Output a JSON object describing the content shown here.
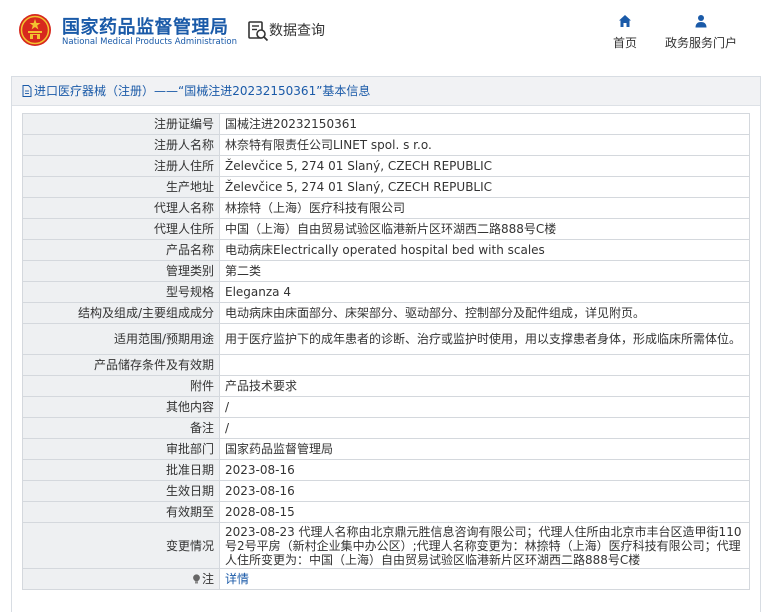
{
  "header": {
    "brand_cn": "国家药品监督管理局",
    "brand_en": "National Medical Products Administration",
    "query_label": "数据查询",
    "nav_home": "首页",
    "nav_portal": "政务服务门户"
  },
  "colors": {
    "brand_blue": "#1a5aa8",
    "label_bg": "#eef0f2",
    "emblem_red": "#d7281e",
    "emblem_gold": "#f2c230"
  },
  "panel": {
    "title": "进口医疗器械（注册）——“国械注进20232150361”基本信息"
  },
  "fields": [
    {
      "label": "注册证编号",
      "value": "国械注进20232150361"
    },
    {
      "label": "注册人名称",
      "value": "林奈特有限责任公司LINET spol. s r.o."
    },
    {
      "label": "注册人住所",
      "value": "Želevčice 5, 274 01 Slaný, CZECH REPUBLIC"
    },
    {
      "label": "生产地址",
      "value": "Želevčice 5, 274 01 Slaný, CZECH REPUBLIC"
    },
    {
      "label": "代理人名称",
      "value": "林捺特（上海）医疗科技有限公司"
    },
    {
      "label": "代理人住所",
      "value": "中国（上海）自由贸易试验区临港新片区环湖西二路888号C楼"
    },
    {
      "label": "产品名称",
      "value": "电动病床Electrically operated hospital bed with scales"
    },
    {
      "label": "管理类别",
      "value": "第二类"
    },
    {
      "label": "型号规格",
      "value": "Eleganza 4"
    },
    {
      "label": "结构及组成/主要组成成分",
      "value": "电动病床由床面部分、床架部分、驱动部分、控制部分及配件组成，详见附页。"
    },
    {
      "label": "适用范围/预期用途",
      "value": "用于医疗监护下的成年患者的诊断、治疗或监护时使用，用以支撑患者身体，形成临床所需体位。"
    },
    {
      "label": "产品储存条件及有效期",
      "value": ""
    },
    {
      "label": "附件",
      "value": "产品技术要求"
    },
    {
      "label": "其他内容",
      "value": "/"
    },
    {
      "label": "备注",
      "value": "/"
    },
    {
      "label": "审批部门",
      "value": "国家药品监督管理局"
    },
    {
      "label": "批准日期",
      "value": "2023-08-16"
    },
    {
      "label": "生效日期",
      "value": "2023-08-16"
    },
    {
      "label": "有效期至",
      "value": "2028-08-15"
    },
    {
      "label": "变更情况",
      "value": "2023-08-23 代理人名称由北京鼎元胜信息咨询有限公司；代理人住所由北京市丰台区造甲街110号2号平房（新村企业集中办公区）;代理人名称变更为：林捺特（上海）医疗科技有限公司；代理人住所变更为：中国（上海）自由贸易试验区临港新片区环湖西二路888号C楼"
    },
    {
      "label": "注",
      "value": "详情"
    }
  ]
}
